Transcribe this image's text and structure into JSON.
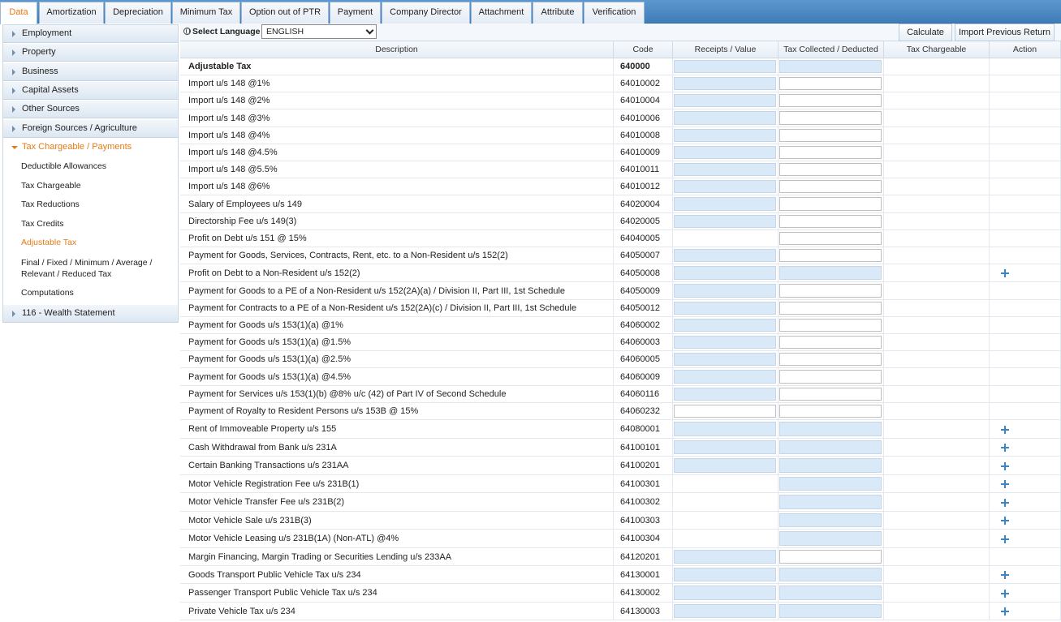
{
  "tabs": [
    {
      "label": "Data",
      "active": true
    },
    {
      "label": "Amortization"
    },
    {
      "label": "Depreciation"
    },
    {
      "label": "Minimum Tax"
    },
    {
      "label": "Option out of PTR"
    },
    {
      "label": "Payment"
    },
    {
      "label": "Company Director"
    },
    {
      "label": "Attachment"
    },
    {
      "label": "Attribute"
    },
    {
      "label": "Verification"
    }
  ],
  "sidebar": {
    "items": [
      {
        "label": "Employment"
      },
      {
        "label": "Property"
      },
      {
        "label": "Business"
      },
      {
        "label": "Capital Assets"
      },
      {
        "label": "Other Sources"
      },
      {
        "label": "Foreign Sources / Agriculture"
      },
      {
        "label": "Tax Chargeable / Payments",
        "open": true
      },
      {
        "label": "116 - Wealth Statement"
      }
    ],
    "subitems": [
      {
        "label": "Deductible Allowances"
      },
      {
        "label": "Tax Chargeable"
      },
      {
        "label": "Tax Reductions"
      },
      {
        "label": "Tax Credits"
      },
      {
        "label": "Adjustable Tax",
        "active": true
      },
      {
        "label": "Final / Fixed / Minimum / Average / Relevant / Reduced Tax"
      },
      {
        "label": "Computations"
      }
    ]
  },
  "toolbar": {
    "language_label": "Select Language",
    "language_value": "ENGLISH",
    "calculate_label": "Calculate",
    "import_label": "Import Previous Return"
  },
  "table": {
    "headers": {
      "description": "Description",
      "code": "Code",
      "receipts": "Receipts / Value",
      "tax_collected": "Tax Collected / Deducted",
      "tax_chargeable": "Tax Chargeable",
      "action": "Action"
    },
    "rows": [
      {
        "desc": "Adjustable Tax",
        "code": "640000",
        "bold": true,
        "rv": "blue",
        "tc": "blue",
        "plus": false
      },
      {
        "desc": "Import u/s 148 @1%",
        "code": "64010002",
        "rv": "blue",
        "tc": "white"
      },
      {
        "desc": "Import u/s 148 @2%",
        "code": "64010004",
        "rv": "blue",
        "tc": "white"
      },
      {
        "desc": "Import u/s 148 @3%",
        "code": "64010006",
        "rv": "blue",
        "tc": "white"
      },
      {
        "desc": "Import u/s 148 @4%",
        "code": "64010008",
        "rv": "blue",
        "tc": "white"
      },
      {
        "desc": "Import u/s 148 @4.5%",
        "code": "64010009",
        "rv": "blue",
        "tc": "white"
      },
      {
        "desc": "Import u/s 148 @5.5%",
        "code": "64010011",
        "rv": "blue",
        "tc": "white"
      },
      {
        "desc": "Import u/s 148 @6%",
        "code": "64010012",
        "rv": "blue",
        "tc": "white"
      },
      {
        "desc": "Salary of Employees u/s 149",
        "code": "64020004",
        "rv": "blue",
        "tc": "white"
      },
      {
        "desc": "Directorship Fee u/s 149(3)",
        "code": "64020005",
        "rv": "blue",
        "tc": "white"
      },
      {
        "desc": "Profit on Debt u/s 151 @ 15%",
        "code": "64040005",
        "rv": "none",
        "tc": "white"
      },
      {
        "desc": "Payment for Goods, Services, Contracts, Rent, etc. to a Non-Resident u/s 152(2)",
        "code": "64050007",
        "rv": "blue",
        "tc": "white"
      },
      {
        "desc": "Profit on Debt to a Non-Resident u/s 152(2)",
        "code": "64050008",
        "rv": "blue",
        "tc": "blue",
        "plus": true
      },
      {
        "desc": "Payment for Goods to a PE of a Non-Resident u/s 152(2A)(a) / Division II, Part III, 1st Schedule",
        "code": "64050009",
        "rv": "blue",
        "tc": "white"
      },
      {
        "desc": "Payment for Contracts to a PE of a Non-Resident u/s 152(2A)(c) / Division II, Part III, 1st Schedule",
        "code": "64050012",
        "rv": "blue",
        "tc": "white"
      },
      {
        "desc": "Payment for Goods u/s 153(1)(a) @1%",
        "code": "64060002",
        "rv": "blue",
        "tc": "white"
      },
      {
        "desc": "Payment for Goods u/s 153(1)(a) @1.5%",
        "code": "64060003",
        "rv": "blue",
        "tc": "white"
      },
      {
        "desc": "Payment for Goods u/s 153(1)(a) @2.5%",
        "code": "64060005",
        "rv": "blue",
        "tc": "white"
      },
      {
        "desc": "Payment for Goods u/s 153(1)(a) @4.5%",
        "code": "64060009",
        "rv": "blue",
        "tc": "white"
      },
      {
        "desc": "Payment for Services u/s 153(1)(b) @8% u/c (42) of Part IV of Second Schedule",
        "code": "64060116",
        "rv": "blue",
        "tc": "white"
      },
      {
        "desc": "Payment of Royalty to Resident Persons u/s 153B @ 15%",
        "code": "64060232",
        "rv": "white",
        "tc": "white"
      },
      {
        "desc": "Rent of Immoveable Property u/s 155",
        "code": "64080001",
        "rv": "blue",
        "tc": "blue",
        "plus": true
      },
      {
        "desc": "Cash Withdrawal from Bank u/s 231A",
        "code": "64100101",
        "rv": "blue",
        "tc": "blue",
        "plus": true
      },
      {
        "desc": "Certain Banking Transactions u/s 231AA",
        "code": "64100201",
        "rv": "blue",
        "tc": "blue",
        "plus": true
      },
      {
        "desc": "Motor Vehicle Registration Fee u/s 231B(1)",
        "code": "64100301",
        "rv": "none",
        "tc": "blue",
        "plus": true
      },
      {
        "desc": "Motor Vehicle Transfer Fee u/s 231B(2)",
        "code": "64100302",
        "rv": "none",
        "tc": "blue",
        "plus": true
      },
      {
        "desc": "Motor Vehicle Sale u/s 231B(3)",
        "code": "64100303",
        "rv": "none",
        "tc": "blue",
        "plus": true
      },
      {
        "desc": "Motor Vehicle Leasing u/s 231B(1A) (Non-ATL) @4%",
        "code": "64100304",
        "rv": "none",
        "tc": "blue",
        "plus": true
      },
      {
        "desc": "Margin Financing, Margin Trading or Securities Lending u/s 233AA",
        "code": "64120201",
        "rv": "blue",
        "tc": "white"
      },
      {
        "desc": "Goods Transport Public Vehicle Tax u/s 234",
        "code": "64130001",
        "rv": "blue",
        "tc": "blue",
        "plus": true
      },
      {
        "desc": "Passenger Transport Public Vehicle Tax u/s 234",
        "code": "64130002",
        "rv": "blue",
        "tc": "blue",
        "plus": true
      },
      {
        "desc": "Private Vehicle Tax u/s 234",
        "code": "64130003",
        "rv": "blue",
        "tc": "blue",
        "plus": true
      }
    ]
  }
}
